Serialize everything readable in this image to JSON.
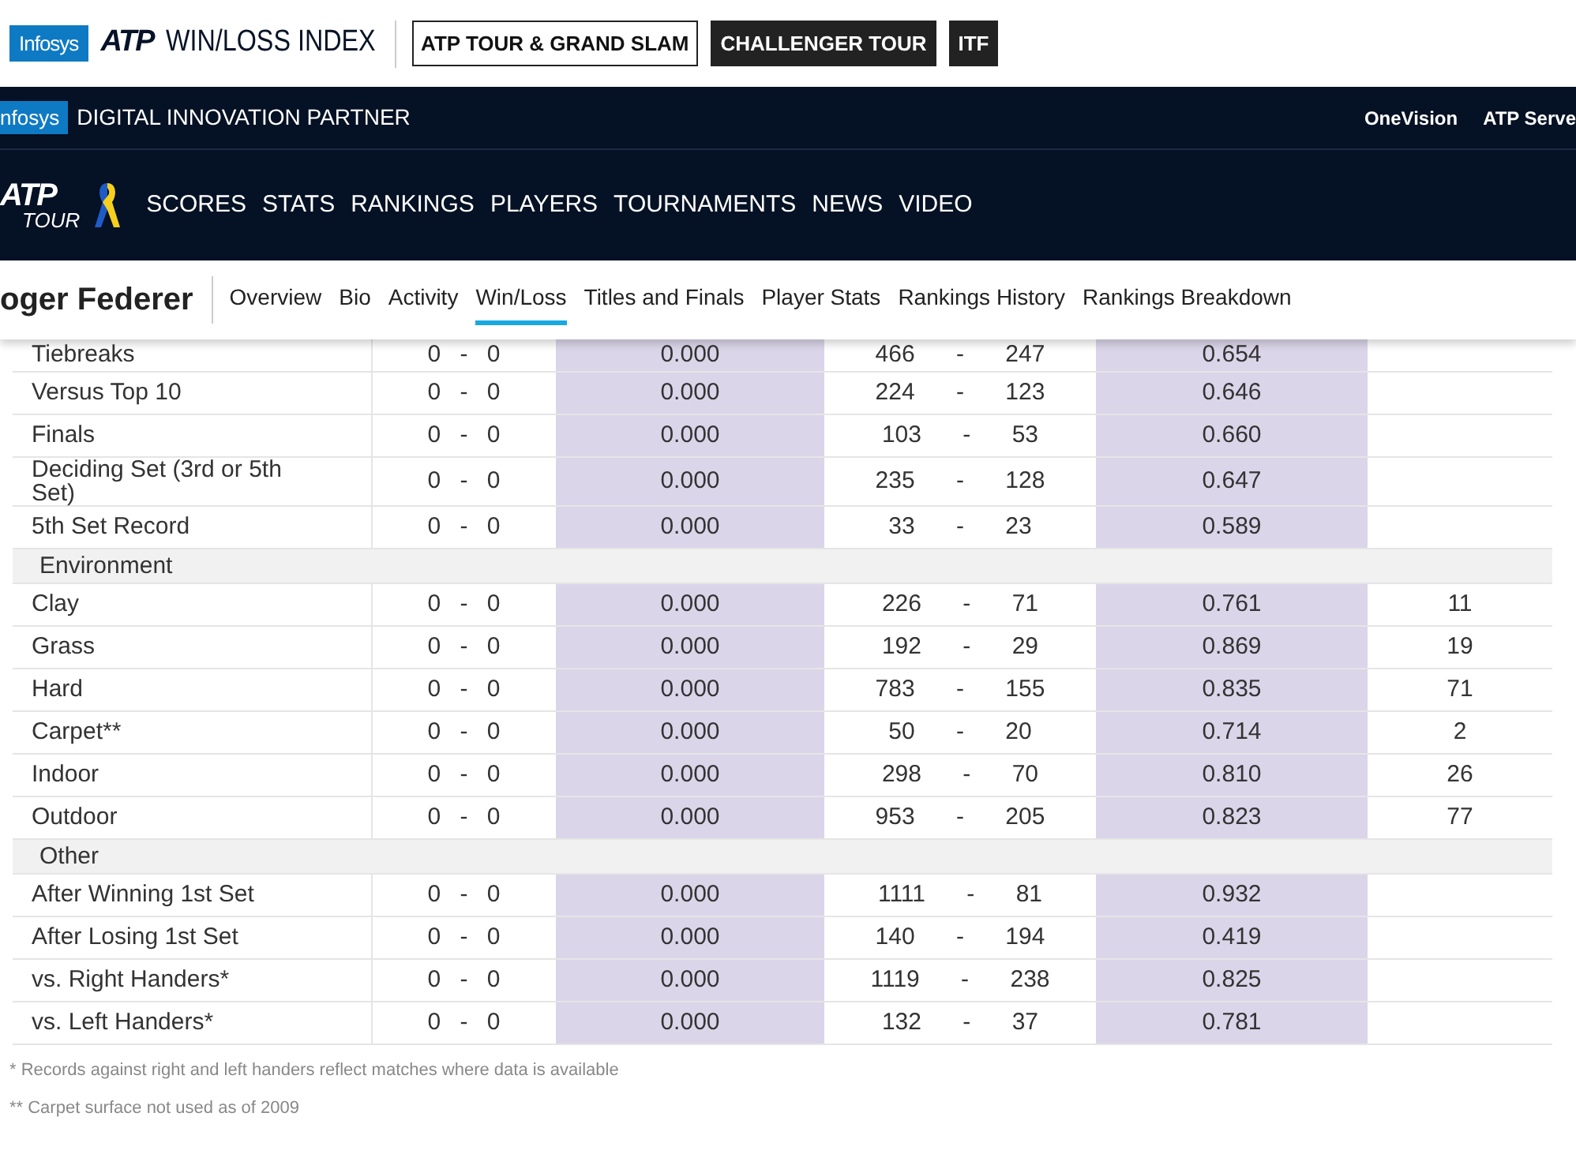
{
  "top_bar": {
    "partner_logo": "Infosys",
    "atp_logo": "ATP",
    "title": "WIN/LOSS INDEX",
    "tour_buttons": [
      {
        "label": "ATP TOUR & GRAND SLAM",
        "selected": true
      },
      {
        "label": "CHALLENGER TOUR",
        "selected": false
      },
      {
        "label": "ITF",
        "selected": false
      }
    ]
  },
  "partner_bar": {
    "logo": "nfosys",
    "label": "DIGITAL INNOVATION PARTNER",
    "links": [
      "OneVision",
      "ATP Serve"
    ]
  },
  "main_nav": {
    "logo": "ATP",
    "logo_sub": "TOUR",
    "items": [
      "SCORES",
      "STATS",
      "RANKINGS",
      "PLAYERS",
      "TOURNAMENTS",
      "NEWS",
      "VIDEO"
    ]
  },
  "player_nav": {
    "player": "oger Federer",
    "tabs": [
      {
        "label": "Overview",
        "selected": false
      },
      {
        "label": "Bio",
        "selected": false
      },
      {
        "label": "Activity",
        "selected": false
      },
      {
        "label": "Win/Loss",
        "selected": true
      },
      {
        "label": "Titles and Finals",
        "selected": false
      },
      {
        "label": "Player Stats",
        "selected": false
      },
      {
        "label": "Rankings History",
        "selected": false
      },
      {
        "label": "Rankings Breakdown",
        "selected": false
      }
    ]
  },
  "table": {
    "rows": [
      {
        "kind": "stat",
        "label": "Tiebreaks",
        "ytd_record": "0 - 0",
        "ytd_pct": "0.000",
        "career_record": "466 - 247",
        "career_pct": "0.654"
      },
      {
        "kind": "stat",
        "label": "Versus Top 10",
        "ytd_record": "0 - 0",
        "ytd_pct": "0.000",
        "career_record": "224 - 123",
        "career_pct": "0.646"
      },
      {
        "kind": "stat",
        "label": "Finals",
        "ytd_record": "0 - 0",
        "ytd_pct": "0.000",
        "career_record": "103 - 53",
        "career_pct": "0.660"
      },
      {
        "kind": "stat",
        "label": "Deciding Set (3rd or 5th Set)",
        "ytd_record": "0 - 0",
        "ytd_pct": "0.000",
        "career_record": "235 - 128",
        "career_pct": "0.647"
      },
      {
        "kind": "stat",
        "label": "5th Set Record",
        "ytd_record": "0 - 0",
        "ytd_pct": "0.000",
        "career_record": "33 - 23",
        "career_pct": "0.589"
      },
      {
        "kind": "section",
        "label": "Environment"
      },
      {
        "kind": "stat",
        "label": "Clay",
        "ytd_record": "0 - 0",
        "ytd_pct": "0.000",
        "career_record": "226 - 71",
        "career_pct": "0.761",
        "titles": "11"
      },
      {
        "kind": "stat",
        "label": "Grass",
        "ytd_record": "0 - 0",
        "ytd_pct": "0.000",
        "career_record": "192 - 29",
        "career_pct": "0.869",
        "titles": "19"
      },
      {
        "kind": "stat",
        "label": "Hard",
        "ytd_record": "0 - 0",
        "ytd_pct": "0.000",
        "career_record": "783 - 155",
        "career_pct": "0.835",
        "titles": "71"
      },
      {
        "kind": "stat",
        "label": "Carpet**",
        "ytd_record": "0 - 0",
        "ytd_pct": "0.000",
        "career_record": "50 - 20",
        "career_pct": "0.714",
        "titles": "2"
      },
      {
        "kind": "stat",
        "label": "Indoor",
        "ytd_record": "0 - 0",
        "ytd_pct": "0.000",
        "career_record": "298 - 70",
        "career_pct": "0.810",
        "titles": "26"
      },
      {
        "kind": "stat",
        "label": "Outdoor",
        "ytd_record": "0 - 0",
        "ytd_pct": "0.000",
        "career_record": "953 - 205",
        "career_pct": "0.823",
        "titles": "77"
      },
      {
        "kind": "section",
        "label": "Other"
      },
      {
        "kind": "stat",
        "label": "After Winning 1st Set",
        "ytd_record": "0 - 0",
        "ytd_pct": "0.000",
        "career_record": "1111 - 81",
        "career_pct": "0.932"
      },
      {
        "kind": "stat",
        "label": "After Losing 1st Set",
        "ytd_record": "0 - 0",
        "ytd_pct": "0.000",
        "career_record": "140 - 194",
        "career_pct": "0.419"
      },
      {
        "kind": "stat",
        "label": "vs. Right Handers*",
        "ytd_record": "0 - 0",
        "ytd_pct": "0.000",
        "career_record": "1119 - 238",
        "career_pct": "0.825"
      },
      {
        "kind": "stat",
        "label": "vs. Left Handers*",
        "ytd_record": "0 - 0",
        "ytd_pct": "0.000",
        "career_record": "132 - 37",
        "career_pct": "0.781"
      }
    ]
  },
  "footnotes": [
    "* Records against right and left handers reflect matches where data is available",
    "** Carpet surface not used as of 2009"
  ]
}
